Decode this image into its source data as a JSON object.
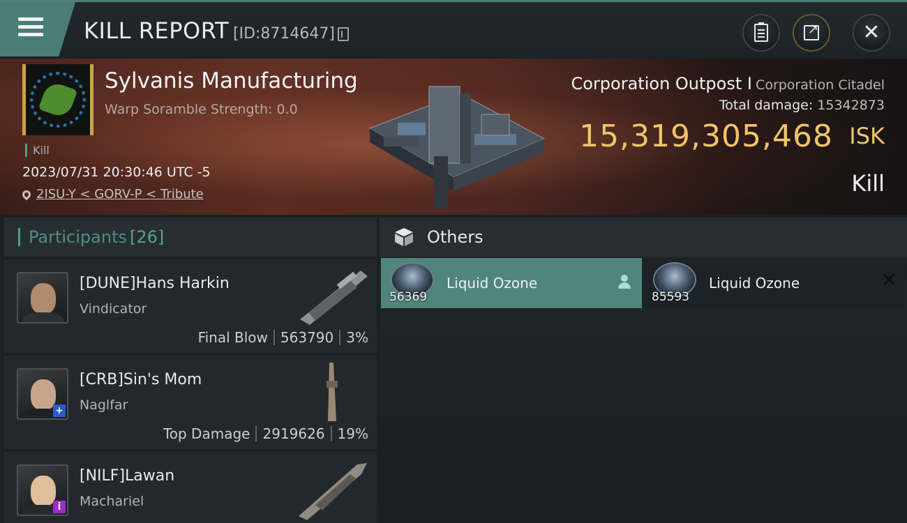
{
  "header": {
    "title": "KILL REPORT",
    "id_label": "[ID:8714647]"
  },
  "victim": {
    "corp_name": "Sylvanis Manufacturing",
    "scramble": "Warp Soramble Strength: 0.0",
    "kill_tag": "Kill",
    "datetime": "2023/07/31 20:30:46 UTC -5",
    "location": "2ISU-Y < GORV-P < Tribute",
    "target_name": "Corporation Outpost I",
    "target_type": "Corporation Citadel",
    "total_damage_label": "Total damage:",
    "total_damage_value": "15342873",
    "isk_value": "15,319,305,468",
    "isk_unit": "ISK",
    "result": "Kill"
  },
  "participants": {
    "label": "Participants",
    "count": "[26]",
    "list": [
      {
        "name": "[DUNE]Hans Harkin",
        "ship": "Vindicator",
        "role": "Final Blow",
        "damage": "563790",
        "percent": "3%"
      },
      {
        "name": "[CRB]Sin's Mom",
        "ship": "Naglfar",
        "role": "Top Damage",
        "damage": "2919626",
        "percent": "19%"
      },
      {
        "name": "[NILF]Lawan",
        "ship": "Machariel"
      }
    ]
  },
  "others": {
    "label": "Others",
    "items": [
      {
        "name": "Liquid Ozone",
        "qty": "56369"
      },
      {
        "name": "Liquid Ozone",
        "qty": "85593"
      }
    ]
  },
  "colors": {
    "accent_teal": "#4f857c",
    "isk_gold": "#f0c46a",
    "corp_logo_frame": "#c9a544"
  }
}
